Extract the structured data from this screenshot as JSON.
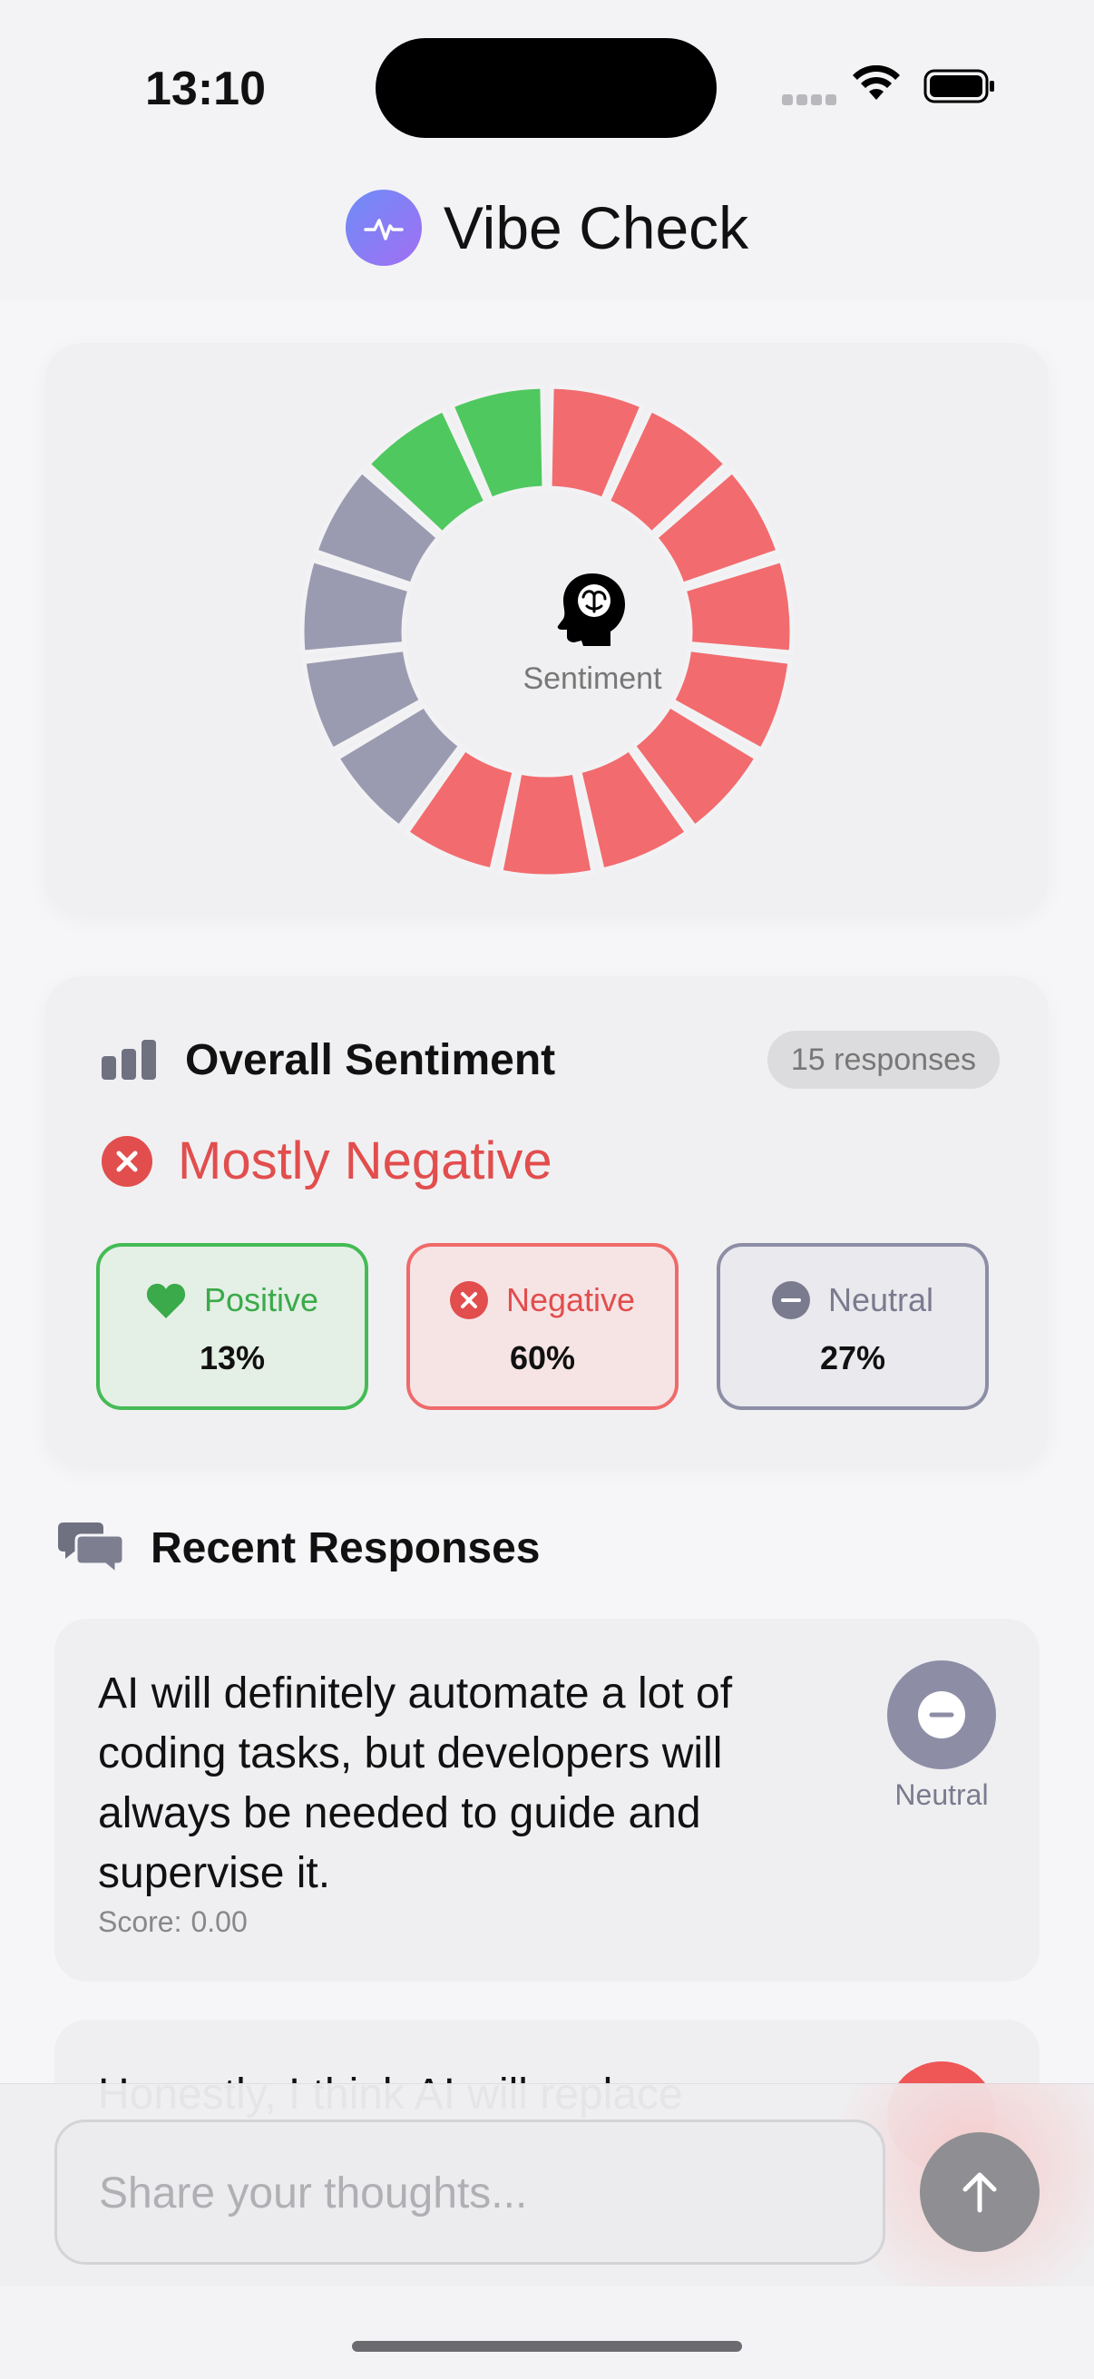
{
  "status_bar": {
    "time": "13:10"
  },
  "header": {
    "title": "Vibe Check"
  },
  "donut": {
    "center_label": "Sentiment",
    "segments": [
      "negative",
      "negative",
      "negative",
      "negative",
      "negative",
      "negative",
      "negative",
      "negative",
      "negative",
      "neutral",
      "neutral",
      "neutral",
      "neutral",
      "positive",
      "positive"
    ],
    "colors": {
      "positive": "#4fc85f",
      "negative": "#f26b6e",
      "neutral": "#9a9bb0"
    }
  },
  "summary": {
    "title": "Overall Sentiment",
    "response_count": "15 responses",
    "verdict": "Mostly Negative",
    "stats": {
      "positive": {
        "label": "Positive",
        "value": "13%"
      },
      "negative": {
        "label": "Negative",
        "value": "60%"
      },
      "neutral": {
        "label": "Neutral",
        "value": "27%"
      }
    }
  },
  "recent": {
    "title": "Recent Responses",
    "items": [
      {
        "text": "AI will definitely automate a lot of coding tasks, but developers will always be needed to guide and supervise it.",
        "score_label": "Score:",
        "score_value": "0.00",
        "sentiment": "Neutral"
      },
      {
        "text": "Honestly, I think AI will replace"
      }
    ]
  },
  "composer": {
    "placeholder": "Share your thoughts..."
  }
}
